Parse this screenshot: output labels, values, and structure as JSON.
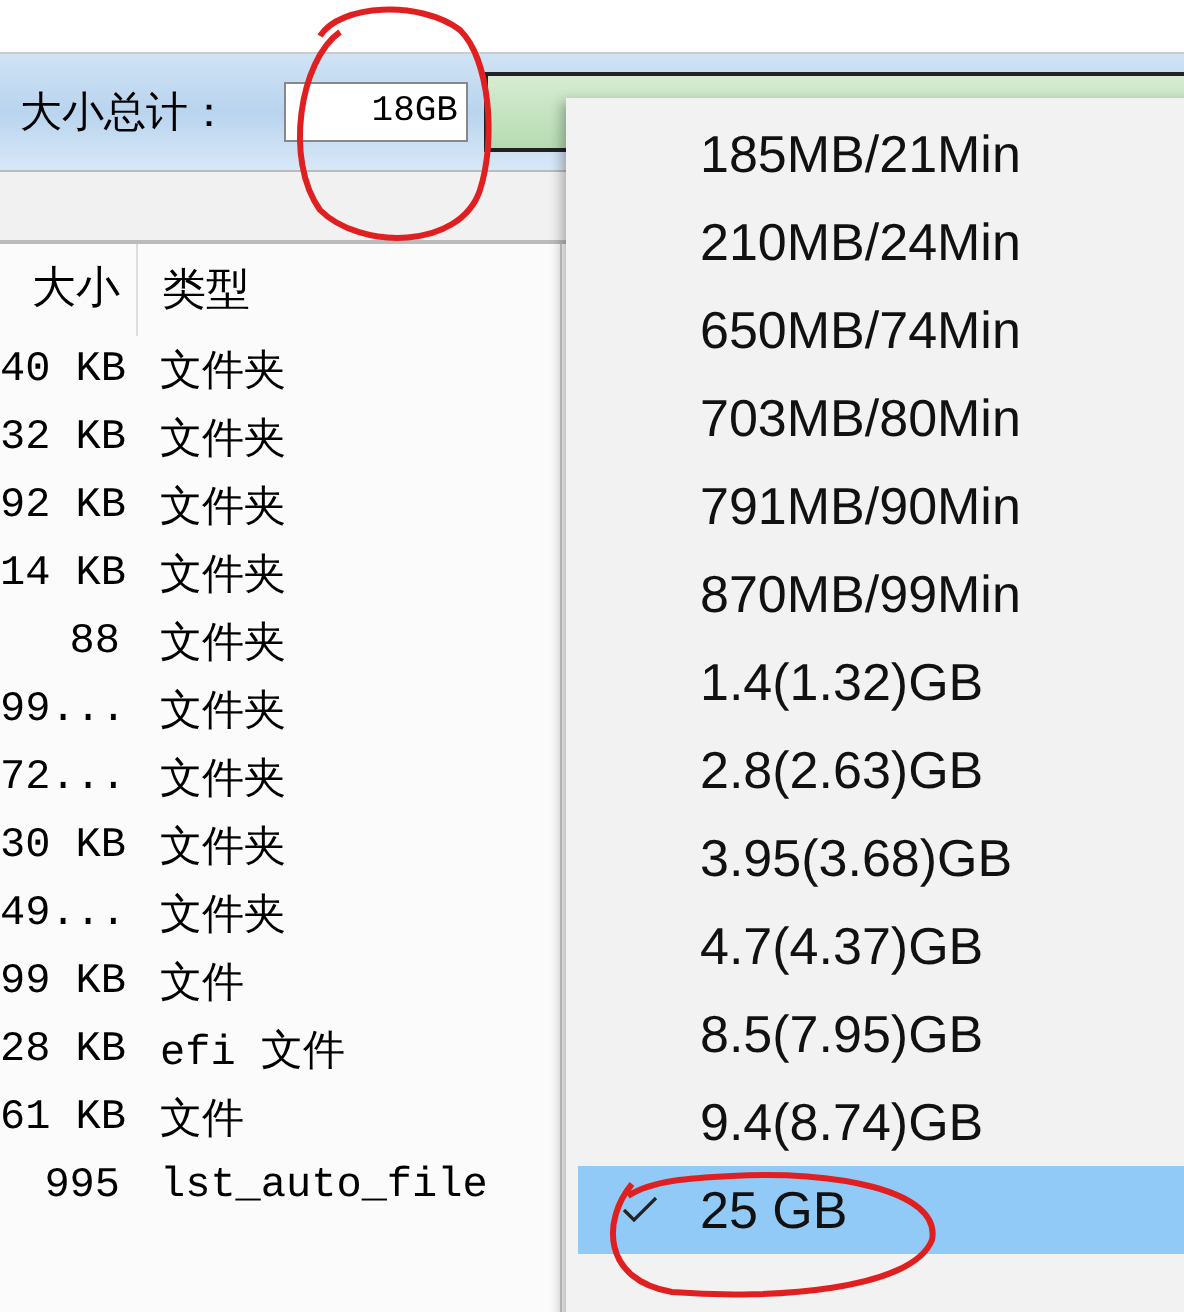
{
  "toolbar": {
    "label": "大小总计：",
    "size_field": {
      "value": "18GB"
    }
  },
  "table": {
    "columns": [
      "大小",
      "类型"
    ],
    "rows": [
      {
        "size": "40 KB",
        "type": "文件夹"
      },
      {
        "size": "32 KB",
        "type": "文件夹"
      },
      {
        "size": "92 KB",
        "type": "文件夹"
      },
      {
        "size": "14 KB",
        "type": "文件夹"
      },
      {
        "size": "88",
        "type": "文件夹"
      },
      {
        "size": "99...",
        "type": "文件夹"
      },
      {
        "size": "72...",
        "type": "文件夹"
      },
      {
        "size": "30 KB",
        "type": "文件夹"
      },
      {
        "size": "49...",
        "type": "文件夹"
      },
      {
        "size": "99 KB",
        "type": "文件"
      },
      {
        "size": "28 KB",
        "type": "efi 文件"
      },
      {
        "size": "61 KB",
        "type": "文件"
      },
      {
        "size": "995",
        "type": "lst_auto_file"
      }
    ]
  },
  "menu": {
    "items": [
      {
        "label": "185MB/21Min",
        "selected": false
      },
      {
        "label": "210MB/24Min",
        "selected": false
      },
      {
        "label": "650MB/74Min",
        "selected": false
      },
      {
        "label": "703MB/80Min",
        "selected": false
      },
      {
        "label": "791MB/90Min",
        "selected": false
      },
      {
        "label": "870MB/99Min",
        "selected": false
      },
      {
        "label": "1.4(1.32)GB",
        "selected": false
      },
      {
        "label": "2.8(2.63)GB",
        "selected": false
      },
      {
        "label": "3.95(3.68)GB",
        "selected": false
      },
      {
        "label": "4.7(4.37)GB",
        "selected": false
      },
      {
        "label": "8.5(7.95)GB",
        "selected": false
      },
      {
        "label": "9.4(8.74)GB",
        "selected": false
      },
      {
        "label": "25 GB",
        "selected": true
      }
    ]
  }
}
